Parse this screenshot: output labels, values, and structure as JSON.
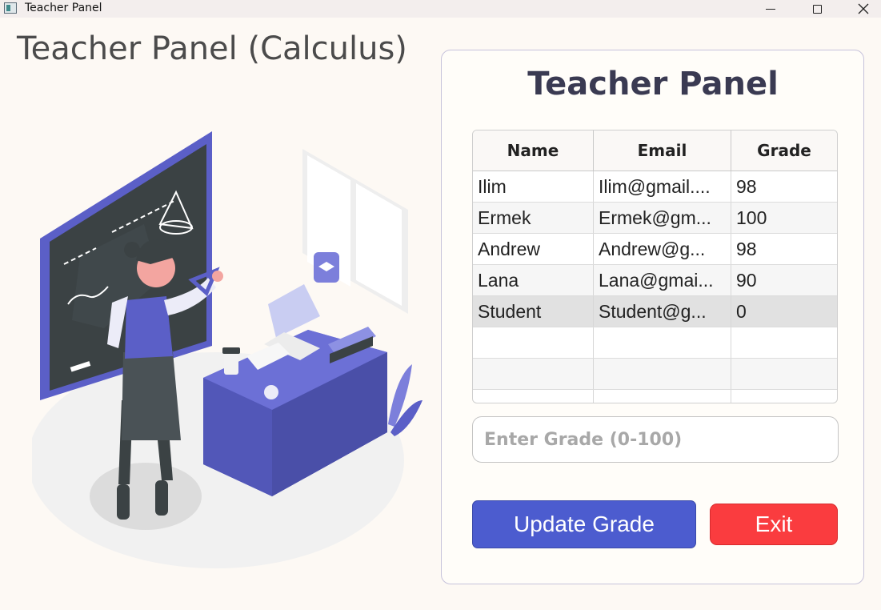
{
  "window": {
    "title": "Teacher Panel"
  },
  "header": {
    "title": "Teacher Panel (Calculus)"
  },
  "panel": {
    "title": "Teacher Panel",
    "table": {
      "columns": [
        "Name",
        "Email",
        "Grade"
      ],
      "rows": [
        {
          "name": "Ilim",
          "email": "Ilim@gmail....",
          "grade": "98"
        },
        {
          "name": "Ermek",
          "email": "Ermek@gm...",
          "grade": "100"
        },
        {
          "name": "Andrew",
          "email": "Andrew@g...",
          "grade": "98"
        },
        {
          "name": "Lana",
          "email": "Lana@gmai...",
          "grade": "90"
        },
        {
          "name": "Student",
          "email": "Student@g...",
          "grade": "0"
        }
      ],
      "selected_row": 4
    },
    "grade_input": {
      "placeholder": "Enter Grade (0-100)",
      "value": ""
    },
    "buttons": {
      "update_label": "Update Grade",
      "exit_label": "Exit"
    }
  },
  "colors": {
    "accent": "#4c5ccf",
    "danger": "#fa3c3f",
    "background": "#fdf9f4"
  }
}
